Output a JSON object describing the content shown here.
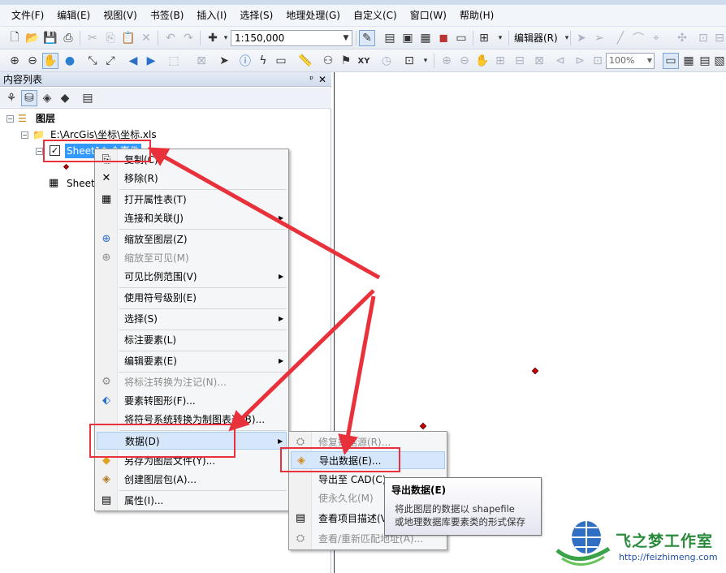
{
  "menubar": {
    "items": [
      "文件(F)",
      "编辑(E)",
      "视图(V)",
      "书签(B)",
      "插入(I)",
      "选择(S)",
      "地理处理(G)",
      "自定义(C)",
      "窗口(W)",
      "帮助(H)"
    ]
  },
  "toolbar": {
    "scale_value": "1:150,000",
    "editor_label": "编辑器(R)",
    "zoom_value": "100%"
  },
  "toc": {
    "title": "内容列表",
    "pin_glyph": "ᵖ",
    "close_glyph": "✕",
    "tree": {
      "root_label": "图层",
      "folder_label": "E:\\ArcGis\\坐标\\坐标.xls",
      "layer_label": "Sheet1$ 个事件",
      "table_label": "Sheet1$"
    }
  },
  "context_menu": {
    "items": [
      {
        "label": "复制(C)",
        "icon": "copy-icon",
        "disabled": false
      },
      {
        "label": "移除(R)",
        "icon": "remove-icon",
        "disabled": false
      },
      {
        "label": "打开属性表(T)",
        "icon": "table-icon",
        "disabled": false
      },
      {
        "label": "连接和关联(J)",
        "icon": "",
        "disabled": false,
        "submenu": true
      },
      {
        "label": "缩放至图层(Z)",
        "icon": "zoom-layer-icon",
        "disabled": false
      },
      {
        "label": "缩放至可见(M)",
        "icon": "zoom-visible-icon",
        "disabled": true
      },
      {
        "label": "可见比例范围(V)",
        "icon": "",
        "disabled": false,
        "submenu": true
      },
      {
        "label": "使用符号级别(E)",
        "icon": "",
        "disabled": false
      },
      {
        "label": "选择(S)",
        "icon": "",
        "disabled": false,
        "submenu": true
      },
      {
        "label": "标注要素(L)",
        "icon": "",
        "disabled": false
      },
      {
        "label": "编辑要素(E)",
        "icon": "",
        "disabled": false,
        "submenu": true
      },
      {
        "label": "将标注转换为注记(N)...",
        "icon": "convert-label-icon",
        "disabled": true
      },
      {
        "label": "要素转图形(F)...",
        "icon": "feature-graphic-icon",
        "disabled": false
      },
      {
        "label": "将符号系统转换为制图表达(B)...",
        "icon": "",
        "disabled": false
      },
      {
        "label": "数据(D)",
        "icon": "",
        "disabled": false,
        "submenu": true,
        "highlighted": true
      },
      {
        "label": "另存为图层文件(Y)...",
        "icon": "layer-file-icon",
        "disabled": false
      },
      {
        "label": "创建图层包(A)...",
        "icon": "layer-package-icon",
        "disabled": false
      },
      {
        "label": "属性(I)...",
        "icon": "properties-icon",
        "disabled": false
      }
    ]
  },
  "data_submenu": {
    "items": [
      {
        "label": "修复数据源(R)...",
        "disabled": true
      },
      {
        "label": "导出数据(E)...",
        "disabled": false,
        "highlighted": true
      },
      {
        "label": "导出至 CAD(C)...",
        "disabled": false
      },
      {
        "label": "使永久化(M)",
        "disabled": true
      },
      {
        "label": "查看项目描述(V)...",
        "disabled": false
      },
      {
        "label": "查看/重新匹配地址(A)...",
        "disabled": true
      }
    ]
  },
  "tooltip": {
    "title": "导出数据(E)",
    "line1": "将此图层的数据以 shapefile",
    "line2": "或地理数据库要素类的形式保存"
  },
  "watermark": {
    "brand": "飞之梦工作室",
    "url": "http://feizhimeng.com"
  },
  "colors": {
    "annotation_red": "#e8313a",
    "selection_blue": "#3399ff",
    "menu_highlight": "#d7e7fb"
  }
}
